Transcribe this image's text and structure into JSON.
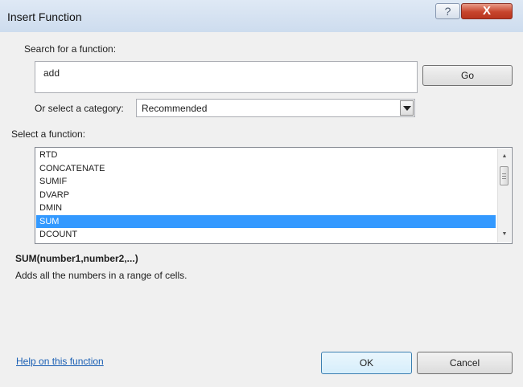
{
  "window": {
    "title": "Insert Function",
    "help_icon": "question-mark-icon",
    "help_glyph": "?",
    "close_icon": "close-icon",
    "close_glyph": "X"
  },
  "search": {
    "label": "Search for a function:",
    "value": "add",
    "go_label": "Go"
  },
  "category": {
    "label": "Or select a category:",
    "selected": "Recommended"
  },
  "functions": {
    "label": "Select a function:",
    "items": [
      "RTD",
      "CONCATENATE",
      "SUMIF",
      "DVARP",
      "DMIN",
      "SUM",
      "DCOUNT"
    ],
    "selected_index": 5
  },
  "details": {
    "signature": "SUM(number1,number2,...)",
    "description": "Adds all the numbers in a range of cells."
  },
  "footer": {
    "help_link": "Help on this function",
    "ok_label": "OK",
    "cancel_label": "Cancel"
  },
  "colors": {
    "selection": "#3399ff",
    "link": "#1a5fb4"
  }
}
